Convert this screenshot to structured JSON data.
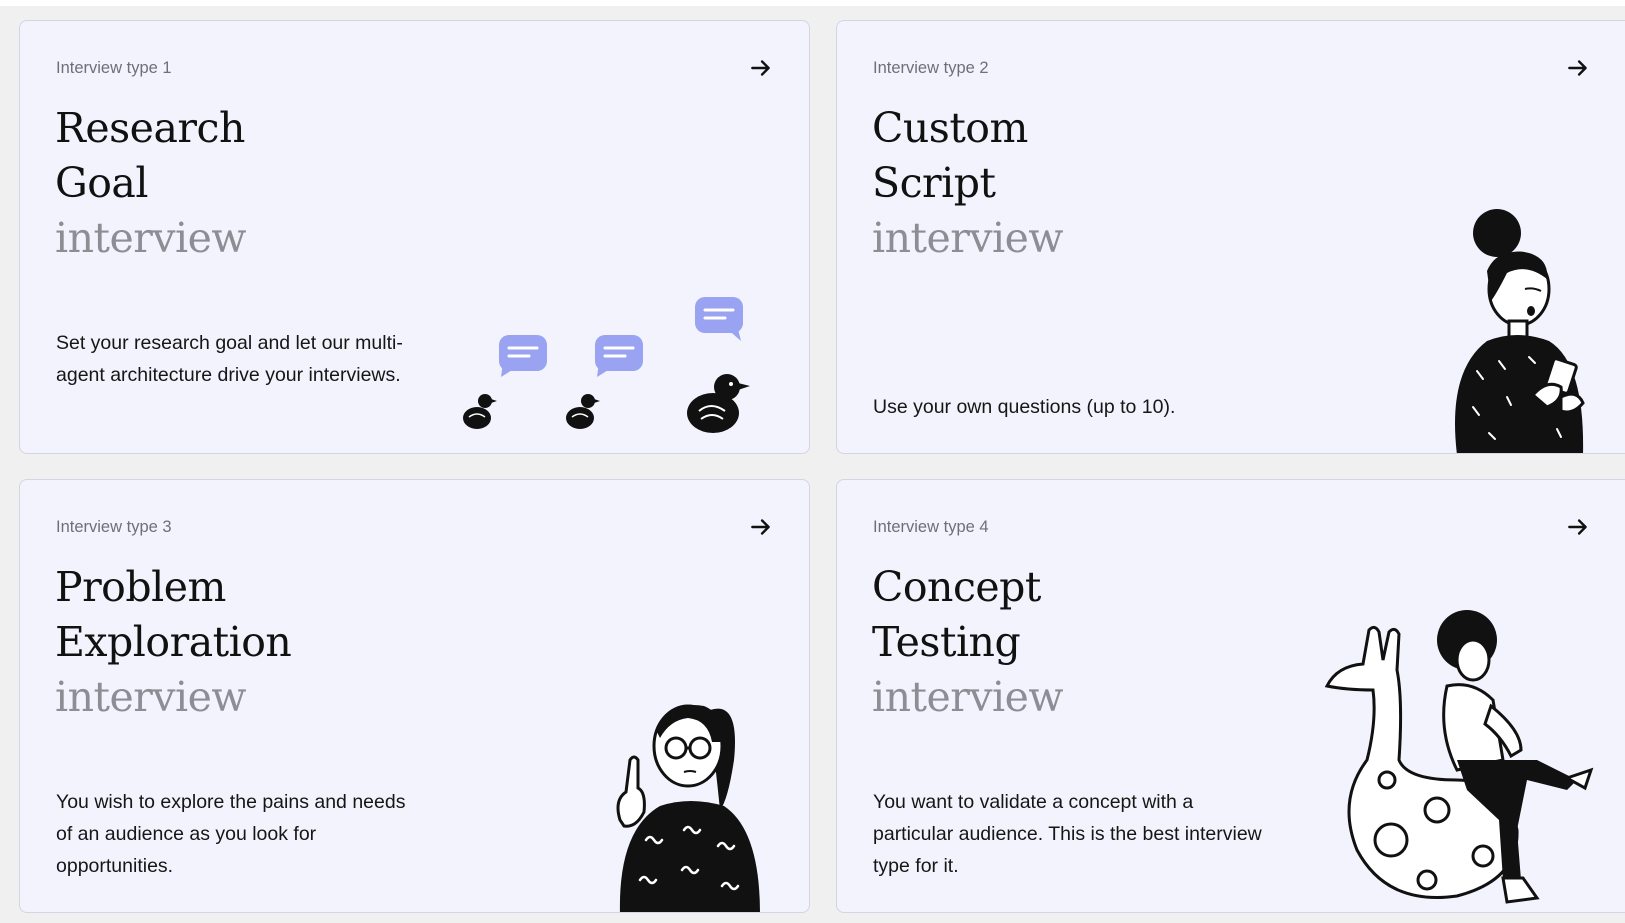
{
  "cards": [
    {
      "label": "Interview type 1",
      "title_line1": "Research",
      "title_line2": "Goal",
      "title_line3": "interview",
      "description": "Set your research goal and let our multi-agent architecture drive your interviews.",
      "illustration": "ducks-chat-illustration"
    },
    {
      "label": "Interview type 2",
      "title_line1": "Custom",
      "title_line2": "Script",
      "title_line3": "interview",
      "description": "Use your own questions (up to 10).",
      "illustration": "woman-phone-illustration"
    },
    {
      "label": "Interview type 3",
      "title_line1": "Problem",
      "title_line2": "Exploration",
      "title_line3": "interview",
      "description": "You wish to explore the pains and needs of an audience as you look for opportunities.",
      "illustration": "woman-idea-illustration"
    },
    {
      "label": "Interview type 4",
      "title_line1": "Concept",
      "title_line2": "Testing",
      "title_line3": "interview",
      "description": "You want to validate a concept with a particular audience. This is the best interview type for it.",
      "illustration": "person-giraffe-illustration"
    }
  ],
  "icons": {
    "card_arrow": "arrow-right-icon"
  },
  "colors": {
    "background": "#f0f0f1",
    "card_bg": "#f3f3fd",
    "card_border": "#d4d4e2",
    "bubble": "#9aa2f2",
    "muted_text": "#8d8d94"
  }
}
